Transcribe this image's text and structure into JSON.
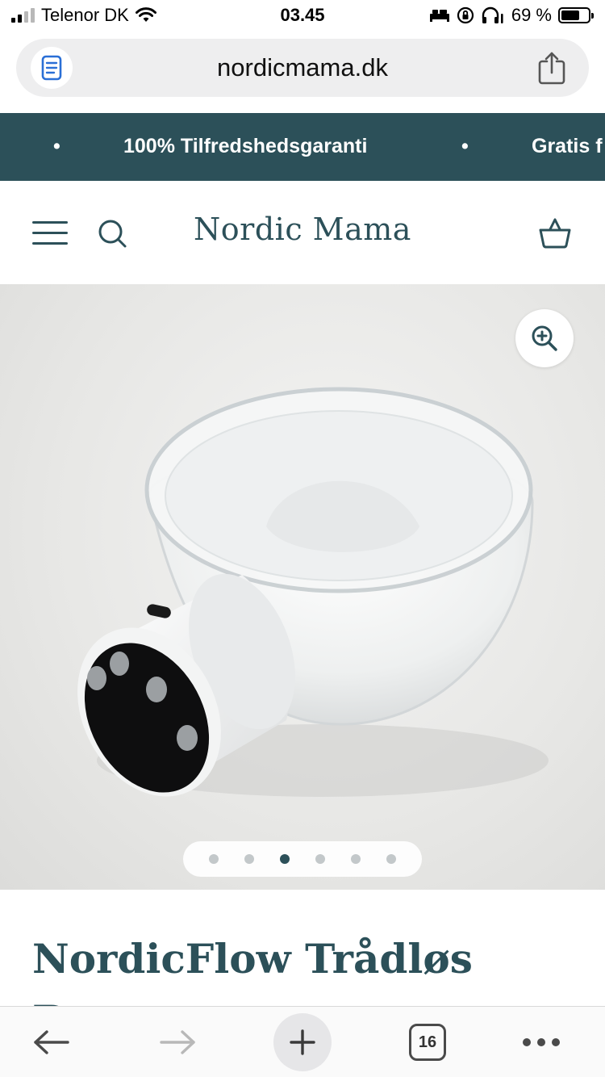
{
  "status_bar": {
    "carrier": "Telenor DK",
    "time": "03.45",
    "battery_percent": "69 %",
    "battery_level": 0.69
  },
  "browser": {
    "url": "nordicmama.dk",
    "reader_icon": "reader-mode-icon",
    "share_icon": "share-icon",
    "tab_count": "16"
  },
  "announcement": {
    "items": [
      "•",
      "100% Tilfredshedsgaranti",
      "•",
      "Gratis f"
    ]
  },
  "header": {
    "brand": "Nordic Mama",
    "menu_icon": "hamburger-menu-icon",
    "search_icon": "search-icon",
    "cart_icon": "basket-icon"
  },
  "gallery": {
    "slide_count": 6,
    "active_index": 2,
    "zoom_icon": "zoom-in-icon"
  },
  "product": {
    "title": "NordicFlow Trådløs Brystpumpe"
  },
  "colors": {
    "brand": "#2c5059",
    "announcement_bg": "#2c5059"
  }
}
